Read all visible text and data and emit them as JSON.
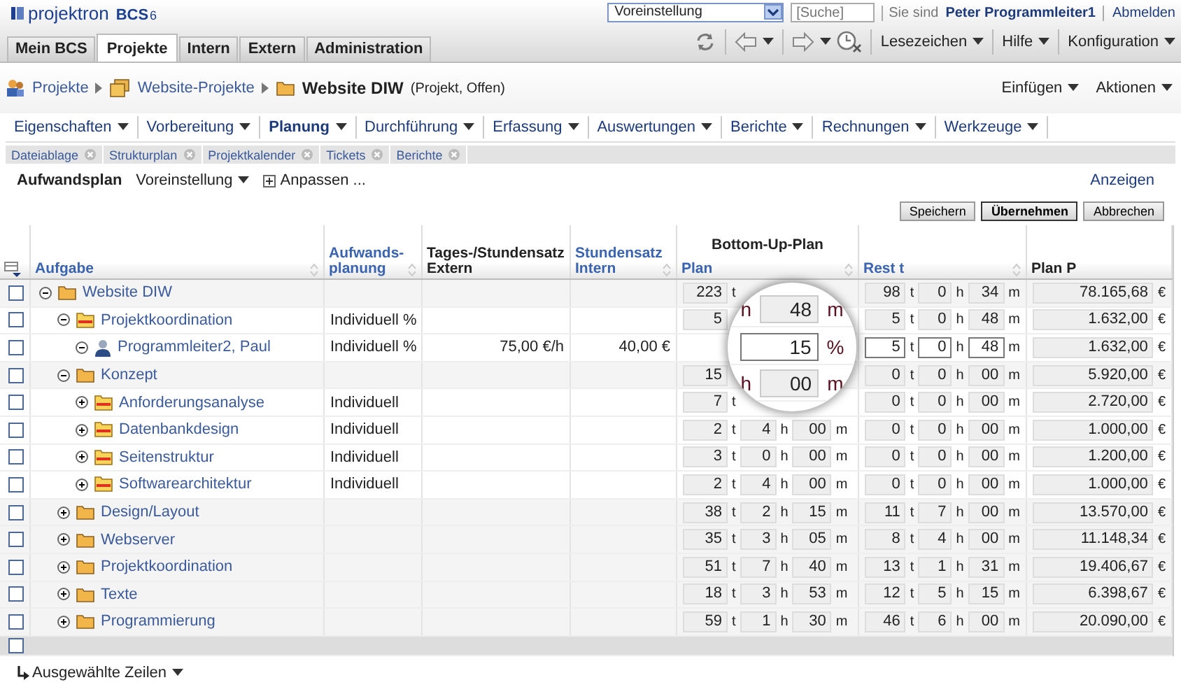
{
  "header": {
    "logo": "projektron",
    "product": "BCS",
    "version": "6",
    "profile_select": "Voreinstellung",
    "search": {
      "placeholder": "[Suche]"
    },
    "user_label": "Sie sind",
    "user": "Peter Programmleiter1",
    "logout": "Abmelden"
  },
  "main_tabs": [
    {
      "label": "Mein BCS",
      "selected": false
    },
    {
      "label": "Projekte",
      "selected": true
    },
    {
      "label": "Intern",
      "selected": false
    },
    {
      "label": "Extern",
      "selected": false
    },
    {
      "label": "Administration",
      "selected": false
    }
  ],
  "toolbar_menus": [
    "Lesezeichen",
    "Hilfe",
    "Konfiguration"
  ],
  "breadcrumb": [
    {
      "label": "Projekte",
      "kind": "people"
    },
    {
      "label": "Website-Projekte",
      "kind": "folders"
    }
  ],
  "current": {
    "label": "Website DIW",
    "note": "(Projekt, Offen)"
  },
  "page_actions": [
    "Einfügen",
    "Aktionen"
  ],
  "menu": [
    {
      "label": "Eigenschaften",
      "selected": false
    },
    {
      "label": "Vorbereitung",
      "selected": false
    },
    {
      "label": "Planung",
      "selected": true
    },
    {
      "label": "Durchführung",
      "selected": false
    },
    {
      "label": "Erfassung",
      "selected": false
    },
    {
      "label": "Auswertungen",
      "selected": false
    },
    {
      "label": "Berichte",
      "selected": false
    },
    {
      "label": "Rechnungen",
      "selected": false
    },
    {
      "label": "Werkzeuge",
      "selected": false
    }
  ],
  "open_tabs": [
    "Dateiablage",
    "Strukturplan",
    "Projektkalender",
    "Tickets",
    "Berichte"
  ],
  "view": {
    "title": "Aufwandsplan",
    "preset": "Voreinstellung",
    "customize": "Anpassen ...",
    "show": "Anzeigen"
  },
  "buttons": [
    {
      "label": "Speichern",
      "primary": false
    },
    {
      "label": "Übernehmen",
      "primary": true
    },
    {
      "label": "Abbrechen",
      "primary": false
    }
  ],
  "table": {
    "group_header": "Bottom-Up-Plan",
    "columns": [
      {
        "label": "Aufgabe",
        "sortable": true
      },
      {
        "label": "Aufwands-planung",
        "sortable": true
      },
      {
        "label": "Tages-/Stundensatz Extern",
        "sortable": false
      },
      {
        "label": "Stundensatz Intern",
        "sortable": true
      },
      {
        "label": "Plan",
        "sortable": true
      },
      {
        "label": "Rest t",
        "sortable": true
      },
      {
        "label": "Plan P",
        "sortable": false
      }
    ],
    "rows": [
      {
        "name": "Website DIW",
        "kind": "summary",
        "expanded": true,
        "checked": false,
        "editable": false,
        "plan": [
          {
            "v": "223",
            "u": "t"
          }
        ],
        "rest": [
          {
            "v": "98",
            "u": "t"
          },
          {
            "v": "0",
            "u": "h"
          },
          {
            "v": "34",
            "u": "m"
          }
        ],
        "plan_p": {
          "v": "78.165,68",
          "u": "€"
        },
        "children": [
          {
            "name": "Projektkoordination",
            "kind": "task",
            "expanded": true,
            "checked": false,
            "editable": false,
            "planning": "Individuell %",
            "plan": [
              {
                "v": "5"
              }
            ],
            "rest": [
              {
                "v": "5",
                "u": "t"
              },
              {
                "v": "0",
                "u": "h"
              },
              {
                "v": "48",
                "u": "m"
              }
            ],
            "plan_p": {
              "v": "1.632,00",
              "u": "€"
            },
            "children": [
              {
                "name": "Programmleiter2, Paul",
                "kind": "person",
                "expanded": true,
                "checked": false,
                "editable": true,
                "planning": "Individuell %",
                "rate_extern": "75,00 €/h",
                "rate_intern": "40,00 €",
                "rest": [
                  {
                    "v": "5",
                    "u": "t"
                  },
                  {
                    "v": "0",
                    "u": "h"
                  },
                  {
                    "v": "48",
                    "u": "m"
                  }
                ],
                "plan_p": {
                  "v": "1.632,00",
                  "u": "€"
                }
              }
            ]
          },
          {
            "name": "Konzept",
            "kind": "summary",
            "expanded": true,
            "checked": false,
            "editable": false,
            "plan": [
              {
                "v": "15"
              }
            ],
            "rest": [
              {
                "v": "0",
                "u": "t"
              },
              {
                "v": "0",
                "u": "h"
              },
              {
                "v": "00",
                "u": "m"
              }
            ],
            "plan_p": {
              "v": "5.920,00",
              "u": "€"
            },
            "children": [
              {
                "name": "Anforderungsanalyse",
                "kind": "task",
                "expanded": false,
                "checked": false,
                "editable": false,
                "planning": "Individuell",
                "plan": [
                  {
                    "v": "7",
                    "u": "t"
                  }
                ],
                "rest": [
                  {
                    "v": "0",
                    "u": "t"
                  },
                  {
                    "v": "0",
                    "u": "h"
                  },
                  {
                    "v": "00",
                    "u": "m"
                  }
                ],
                "plan_p": {
                  "v": "2.720,00",
                  "u": "€"
                }
              },
              {
                "name": "Datenbankdesign",
                "kind": "task",
                "expanded": false,
                "checked": false,
                "editable": false,
                "planning": "Individuell",
                "plan": [
                  {
                    "v": "2",
                    "u": "t"
                  },
                  {
                    "v": "4",
                    "u": "h"
                  },
                  {
                    "v": "00",
                    "u": "m"
                  }
                ],
                "rest": [
                  {
                    "v": "0",
                    "u": "t"
                  },
                  {
                    "v": "0",
                    "u": "h"
                  },
                  {
                    "v": "00",
                    "u": "m"
                  }
                ],
                "plan_p": {
                  "v": "1.000,00",
                  "u": "€"
                }
              },
              {
                "name": "Seitenstruktur",
                "kind": "task",
                "expanded": false,
                "checked": false,
                "editable": false,
                "planning": "Individuell",
                "plan": [
                  {
                    "v": "3",
                    "u": "t"
                  },
                  {
                    "v": "0",
                    "u": "h"
                  },
                  {
                    "v": "00",
                    "u": "m"
                  }
                ],
                "rest": [
                  {
                    "v": "0",
                    "u": "t"
                  },
                  {
                    "v": "0",
                    "u": "h"
                  },
                  {
                    "v": "00",
                    "u": "m"
                  }
                ],
                "plan_p": {
                  "v": "1.200,00",
                  "u": "€"
                }
              },
              {
                "name": "Softwarearchitektur",
                "kind": "task",
                "expanded": false,
                "checked": false,
                "editable": false,
                "planning": "Individuell",
                "plan": [
                  {
                    "v": "2",
                    "u": "t"
                  },
                  {
                    "v": "4",
                    "u": "h"
                  },
                  {
                    "v": "00",
                    "u": "m"
                  }
                ],
                "rest": [
                  {
                    "v": "0",
                    "u": "t"
                  },
                  {
                    "v": "0",
                    "u": "h"
                  },
                  {
                    "v": "00",
                    "u": "m"
                  }
                ],
                "plan_p": {
                  "v": "1.000,00",
                  "u": "€"
                }
              }
            ]
          },
          {
            "name": "Design/Layout",
            "kind": "summary",
            "expanded": false,
            "checked": false,
            "editable": false,
            "plan": [
              {
                "v": "38",
                "u": "t"
              },
              {
                "v": "2",
                "u": "h"
              },
              {
                "v": "15",
                "u": "m"
              }
            ],
            "rest": [
              {
                "v": "11",
                "u": "t"
              },
              {
                "v": "7",
                "u": "h"
              },
              {
                "v": "00",
                "u": "m"
              }
            ],
            "plan_p": {
              "v": "13.570,00",
              "u": "€"
            }
          },
          {
            "name": "Webserver",
            "kind": "summary",
            "expanded": false,
            "checked": false,
            "editable": false,
            "plan": [
              {
                "v": "35",
                "u": "t"
              },
              {
                "v": "3",
                "u": "h"
              },
              {
                "v": "05",
                "u": "m"
              }
            ],
            "rest": [
              {
                "v": "8",
                "u": "t"
              },
              {
                "v": "4",
                "u": "h"
              },
              {
                "v": "00",
                "u": "m"
              }
            ],
            "plan_p": {
              "v": "11.148,34",
              "u": "€"
            }
          },
          {
            "name": "Projektkoordination",
            "kind": "summary",
            "expanded": false,
            "checked": false,
            "editable": false,
            "plan": [
              {
                "v": "51",
                "u": "t"
              },
              {
                "v": "7",
                "u": "h"
              },
              {
                "v": "40",
                "u": "m"
              }
            ],
            "rest": [
              {
                "v": "13",
                "u": "t"
              },
              {
                "v": "1",
                "u": "h"
              },
              {
                "v": "31",
                "u": "m"
              }
            ],
            "plan_p": {
              "v": "19.406,67",
              "u": "€"
            }
          },
          {
            "name": "Texte",
            "kind": "summary",
            "expanded": false,
            "checked": false,
            "editable": false,
            "plan": [
              {
                "v": "18",
                "u": "t"
              },
              {
                "v": "3",
                "u": "h"
              },
              {
                "v": "53",
                "u": "m"
              }
            ],
            "rest": [
              {
                "v": "12",
                "u": "t"
              },
              {
                "v": "5",
                "u": "h"
              },
              {
                "v": "15",
                "u": "m"
              }
            ],
            "plan_p": {
              "v": "6.398,67",
              "u": "€"
            }
          },
          {
            "name": "Programmierung",
            "kind": "summary",
            "expanded": false,
            "checked": false,
            "editable": false,
            "plan": [
              {
                "v": "59",
                "u": "t"
              },
              {
                "v": "1",
                "u": "h"
              },
              {
                "v": "30",
                "u": "m"
              }
            ],
            "rest": [
              {
                "v": "46",
                "u": "t"
              },
              {
                "v": "6",
                "u": "h"
              },
              {
                "v": "00",
                "u": "m"
              }
            ],
            "plan_p": {
              "v": "20.090,00",
              "u": "€"
            }
          }
        ]
      }
    ],
    "select_all": {
      "checked": false
    },
    "magnifier": [
      {
        "pre": "h",
        "v": "48",
        "u": "m",
        "editable": false
      },
      {
        "v": "15",
        "u": "%",
        "editable": true
      },
      {
        "pre": "h",
        "v": "00",
        "u": "m",
        "editable": false
      }
    ]
  },
  "footer": {
    "selected_rows": "Ausgewählte Zeilen"
  }
}
